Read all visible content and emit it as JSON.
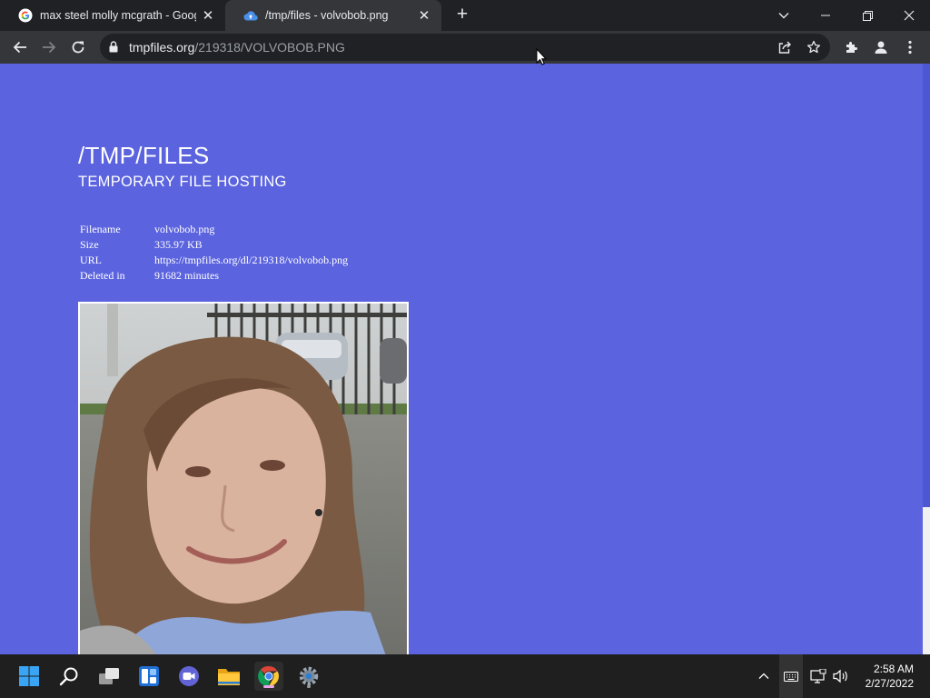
{
  "browser": {
    "tabs": [
      {
        "title": "max steel molly mcgrath - Google",
        "favicon": "google-g-icon"
      },
      {
        "title": "/tmp/files - volvobob.png",
        "favicon": "cloud-upload-icon"
      }
    ],
    "address": {
      "host": "tmpfiles.org",
      "path": "/219318/VOLVOBOB.PNG"
    }
  },
  "page": {
    "title": "/TMP/FILES",
    "subtitle": "TEMPORARY FILE HOSTING",
    "file_info": [
      {
        "key": "Filename",
        "value": "volvobob.png"
      },
      {
        "key": "Size",
        "value": "335.97 KB"
      },
      {
        "key": "URL",
        "value": "https://tmpfiles.org/dl/219318/volvobob.png"
      },
      {
        "key": "Deleted in",
        "value": "91682 minutes"
      }
    ],
    "background_color": "#5b63de"
  },
  "taskbar": {
    "apps": [
      "start-icon",
      "search-icon",
      "task-view-icon",
      "widgets-icon",
      "teams-chat-icon",
      "file-explorer-icon",
      "chrome-icon",
      "settings-icon"
    ],
    "clock": {
      "time": "2:58 AM",
      "date": "2/27/2022"
    }
  }
}
